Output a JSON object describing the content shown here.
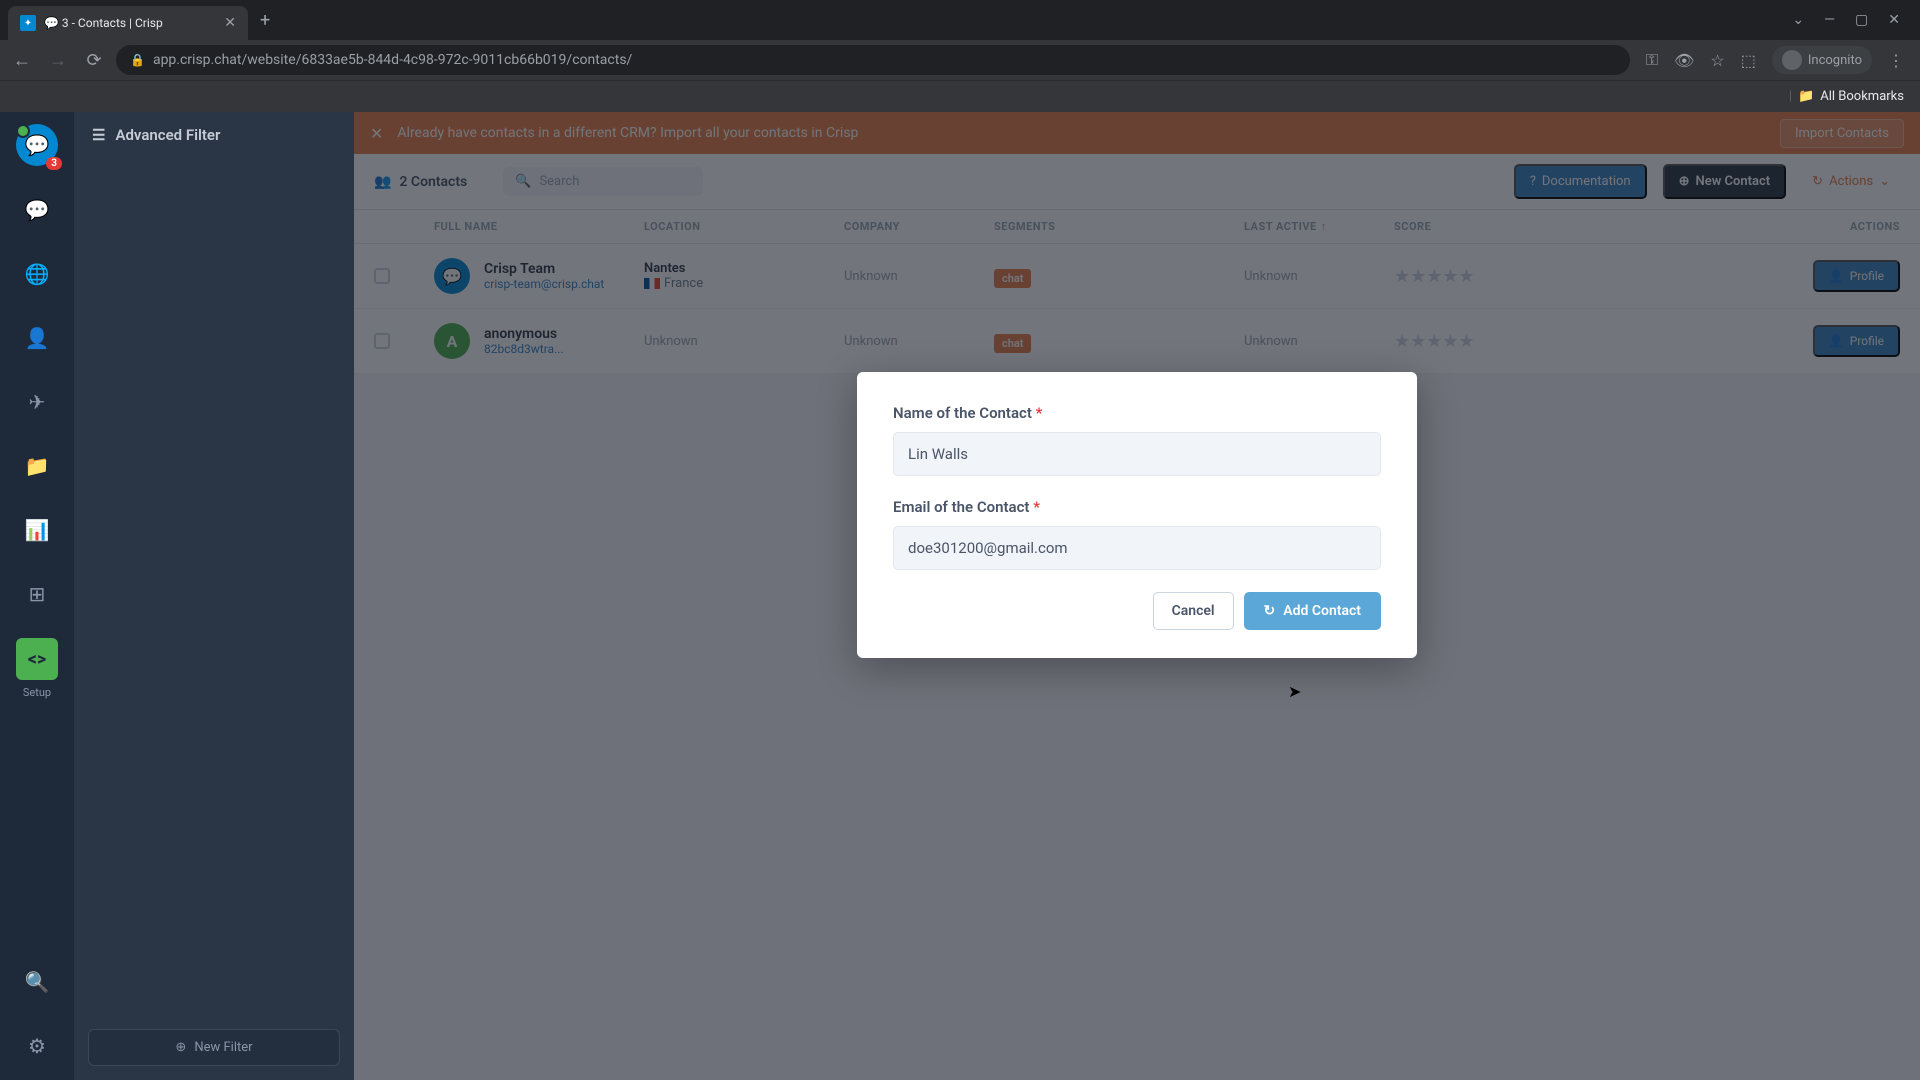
{
  "browser": {
    "tab_title": "💬 3 - Contacts | Crisp",
    "url": "app.crisp.chat/website/6833ae5b-844d-4c98-972c-9011cb66b019/contacts/",
    "incognito_label": "Incognito",
    "bookmarks_label": "All Bookmarks"
  },
  "sidebar": {
    "badge_count": "3",
    "setup_label": "Setup",
    "filter_title": "Advanced Filter",
    "new_filter_label": "New Filter"
  },
  "banner": {
    "text": "Already have contacts in a different CRM? Import all your contacts in Crisp",
    "import_label": "Import Contacts"
  },
  "toolbar": {
    "count_label": "2 Contacts",
    "search_placeholder": "Search",
    "doc_label": "Documentation",
    "new_contact_label": "New Contact",
    "actions_label": "Actions"
  },
  "table": {
    "headers": {
      "name": "FULL NAME",
      "location": "LOCATION",
      "company": "COMPANY",
      "segments": "SEGMENTS",
      "last_active": "LAST ACTIVE",
      "score": "SCORE",
      "actions": "ACTIONS"
    },
    "rows": [
      {
        "name": "Crisp Team",
        "email": "crisp-team@crisp.chat",
        "city": "Nantes",
        "country": "France",
        "company": "Unknown",
        "segment": "chat",
        "last_active": "Unknown",
        "avatar_bg": "#0288d1",
        "profile_label": "Profile"
      },
      {
        "name": "anonymous",
        "email": "82bc8d3wtra...",
        "city": "Unknown",
        "country": "",
        "company": "Unknown",
        "segment": "chat",
        "last_active": "Unknown",
        "avatar_bg": "#4caf50",
        "profile_label": "Profile"
      }
    ]
  },
  "modal": {
    "name_label": "Name of the Contact",
    "name_value": "Lin Walls",
    "email_label": "Email of the Contact",
    "email_value": "doe301200@gmail.com",
    "cancel_label": "Cancel",
    "add_label": "Add Contact"
  }
}
